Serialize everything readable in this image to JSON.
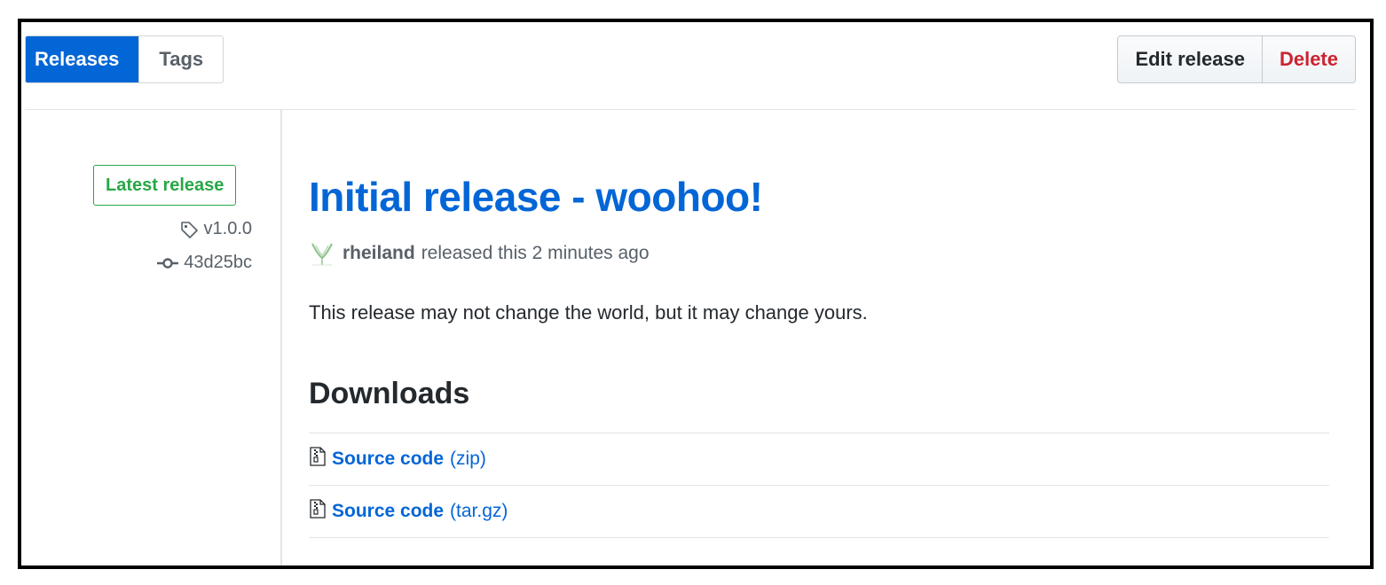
{
  "nav": {
    "tabs": [
      {
        "label": "Releases",
        "active": true
      },
      {
        "label": "Tags",
        "active": false
      }
    ]
  },
  "actions": {
    "edit_label": "Edit release",
    "delete_label": "Delete"
  },
  "sidebar": {
    "badge": "Latest release",
    "tag": "v1.0.0",
    "commit": "43d25bc"
  },
  "release": {
    "title": "Initial release - woohoo!",
    "author": "rheiland",
    "byline": "released this 2 minutes ago",
    "body": "This release may not change the world, but it may change yours."
  },
  "downloads": {
    "heading": "Downloads",
    "items": [
      {
        "label": "Source code",
        "ext": "(zip)"
      },
      {
        "label": "Source code",
        "ext": "(tar.gz)"
      }
    ]
  },
  "colors": {
    "accent": "#0366d6",
    "success": "#28a745",
    "danger": "#cb2431"
  },
  "icons": [
    "tag-icon",
    "commit-icon",
    "file-zip-icon",
    "avatar"
  ]
}
